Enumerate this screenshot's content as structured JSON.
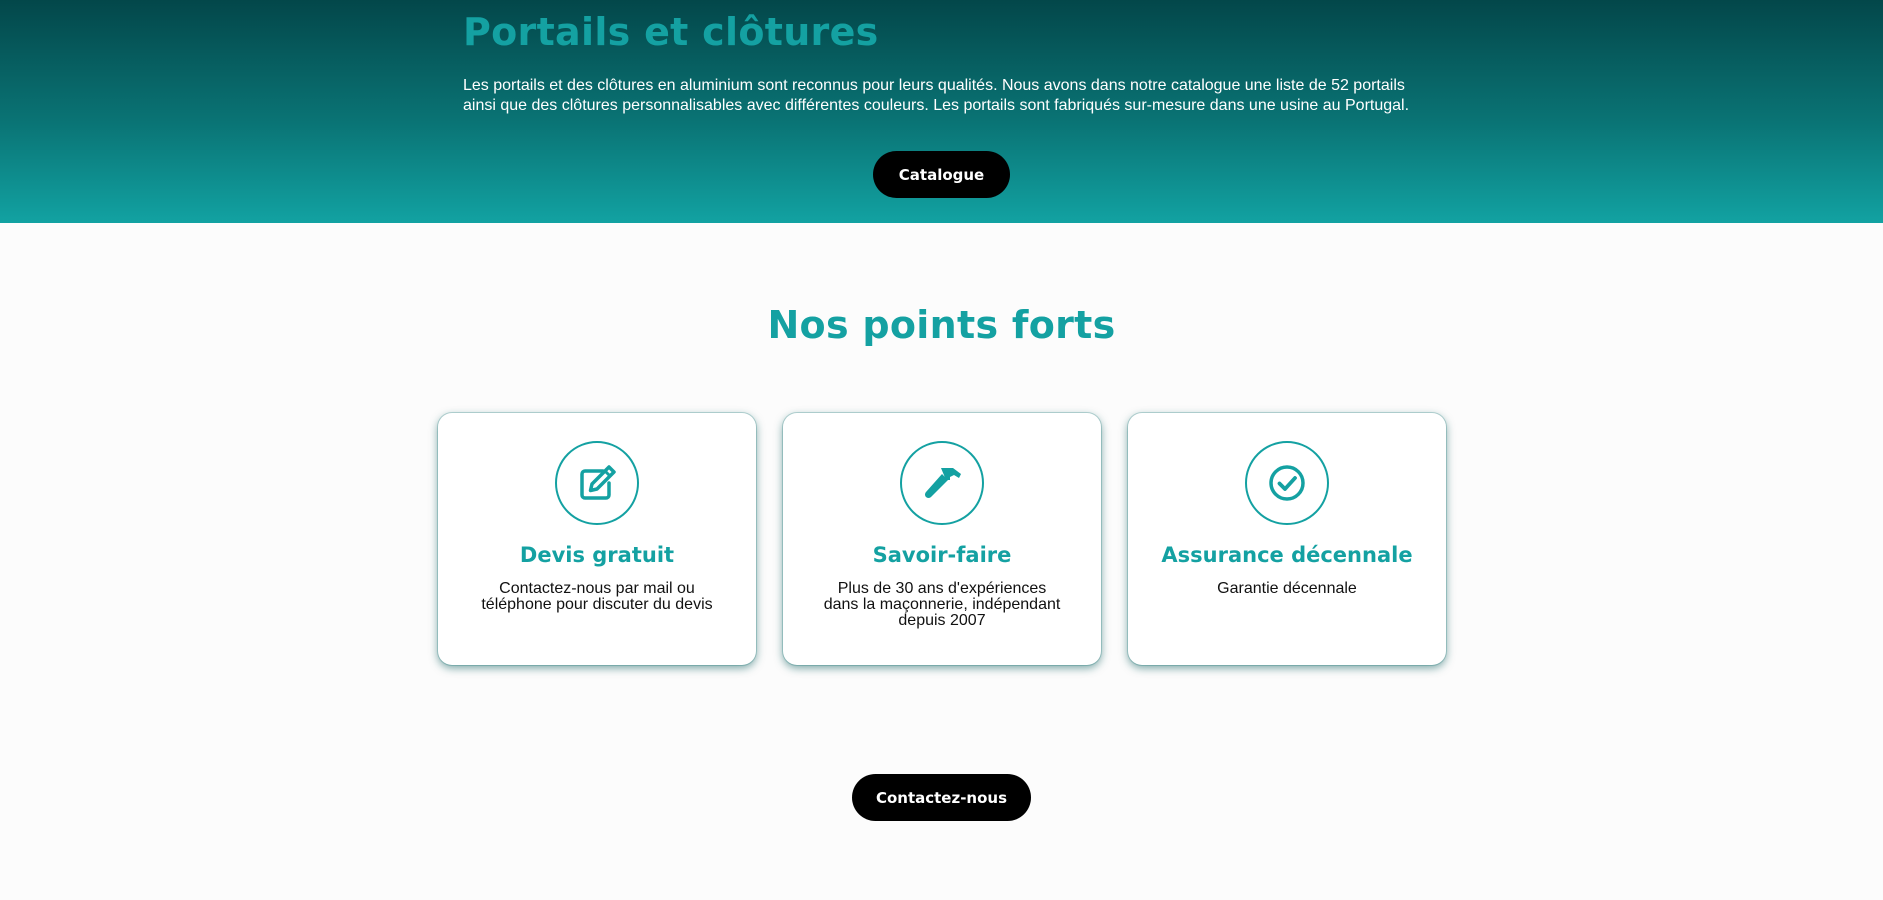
{
  "hero": {
    "title": "Portails et clôtures",
    "description": "Les portails et des clôtures en aluminium sont reconnus pour leurs qualités. Nous avons dans notre catalogue une liste de 52 portails ainsi que des clôtures personnalisables avec différentes couleurs. Les portails sont fabriqués sur-mesure dans une usine au Portugal.",
    "button_label": "Catalogue"
  },
  "strengths": {
    "title": "Nos points forts",
    "cards": [
      {
        "icon": "edit-icon",
        "title": "Devis gratuit",
        "text": "Contactez-nous par mail ou téléphone pour discuter du devis"
      },
      {
        "icon": "hammer-icon",
        "title": "Savoir-faire",
        "text": "Plus de 30 ans d'expériences dans la maçonnerie, indépendant depuis 2007"
      },
      {
        "icon": "check-circle-icon",
        "title": "Assurance décennale",
        "text": "Garantie décennale"
      }
    ]
  },
  "contact": {
    "button_label": "Contactez-nous"
  },
  "colors": {
    "accent": "#14a1a2",
    "hero_top": "#03474a",
    "hero_bottom": "#12a2a2",
    "button": "#000000"
  }
}
